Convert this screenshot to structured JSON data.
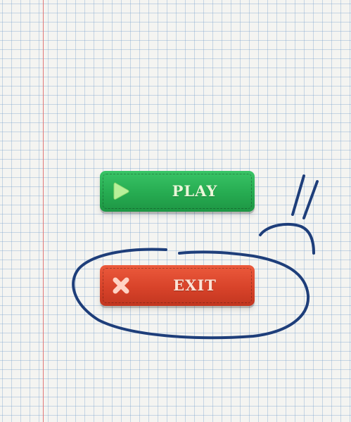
{
  "menu": {
    "play": {
      "label": "PLAY",
      "icon": "play-icon",
      "color": "#2bb358"
    },
    "exit": {
      "label": "EXIT",
      "icon": "close-icon",
      "color": "#d8432a"
    }
  },
  "background": {
    "paper_color": "#f4f4f1",
    "grid_color": "#9fbcd9",
    "margin_line_color": "#e07878"
  },
  "annotation": {
    "type": "hand-drawn circle around exit button",
    "ink_color": "#1e3e7a"
  }
}
